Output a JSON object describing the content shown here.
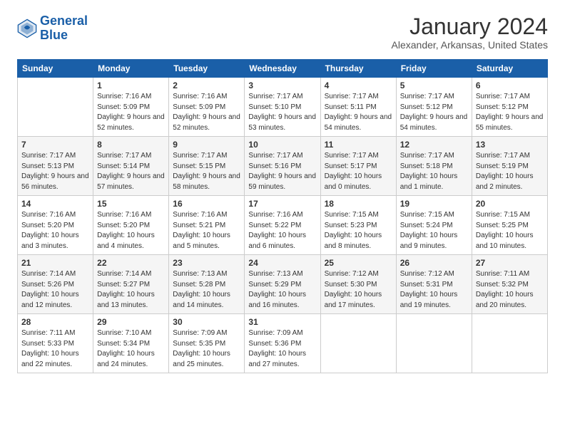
{
  "logo": {
    "line1": "General",
    "line2": "Blue"
  },
  "title": "January 2024",
  "subtitle": "Alexander, Arkansas, United States",
  "weekdays": [
    "Sunday",
    "Monday",
    "Tuesday",
    "Wednesday",
    "Thursday",
    "Friday",
    "Saturday"
  ],
  "weeks": [
    [
      {
        "day": "",
        "sunrise": "",
        "sunset": "",
        "daylight": ""
      },
      {
        "day": "1",
        "sunrise": "Sunrise: 7:16 AM",
        "sunset": "Sunset: 5:09 PM",
        "daylight": "Daylight: 9 hours and 52 minutes."
      },
      {
        "day": "2",
        "sunrise": "Sunrise: 7:16 AM",
        "sunset": "Sunset: 5:09 PM",
        "daylight": "Daylight: 9 hours and 52 minutes."
      },
      {
        "day": "3",
        "sunrise": "Sunrise: 7:17 AM",
        "sunset": "Sunset: 5:10 PM",
        "daylight": "Daylight: 9 hours and 53 minutes."
      },
      {
        "day": "4",
        "sunrise": "Sunrise: 7:17 AM",
        "sunset": "Sunset: 5:11 PM",
        "daylight": "Daylight: 9 hours and 54 minutes."
      },
      {
        "day": "5",
        "sunrise": "Sunrise: 7:17 AM",
        "sunset": "Sunset: 5:12 PM",
        "daylight": "Daylight: 9 hours and 54 minutes."
      },
      {
        "day": "6",
        "sunrise": "Sunrise: 7:17 AM",
        "sunset": "Sunset: 5:12 PM",
        "daylight": "Daylight: 9 hours and 55 minutes."
      }
    ],
    [
      {
        "day": "7",
        "sunrise": "Sunrise: 7:17 AM",
        "sunset": "Sunset: 5:13 PM",
        "daylight": "Daylight: 9 hours and 56 minutes."
      },
      {
        "day": "8",
        "sunrise": "Sunrise: 7:17 AM",
        "sunset": "Sunset: 5:14 PM",
        "daylight": "Daylight: 9 hours and 57 minutes."
      },
      {
        "day": "9",
        "sunrise": "Sunrise: 7:17 AM",
        "sunset": "Sunset: 5:15 PM",
        "daylight": "Daylight: 9 hours and 58 minutes."
      },
      {
        "day": "10",
        "sunrise": "Sunrise: 7:17 AM",
        "sunset": "Sunset: 5:16 PM",
        "daylight": "Daylight: 9 hours and 59 minutes."
      },
      {
        "day": "11",
        "sunrise": "Sunrise: 7:17 AM",
        "sunset": "Sunset: 5:17 PM",
        "daylight": "Daylight: 10 hours and 0 minutes."
      },
      {
        "day": "12",
        "sunrise": "Sunrise: 7:17 AM",
        "sunset": "Sunset: 5:18 PM",
        "daylight": "Daylight: 10 hours and 1 minute."
      },
      {
        "day": "13",
        "sunrise": "Sunrise: 7:17 AM",
        "sunset": "Sunset: 5:19 PM",
        "daylight": "Daylight: 10 hours and 2 minutes."
      }
    ],
    [
      {
        "day": "14",
        "sunrise": "Sunrise: 7:16 AM",
        "sunset": "Sunset: 5:20 PM",
        "daylight": "Daylight: 10 hours and 3 minutes."
      },
      {
        "day": "15",
        "sunrise": "Sunrise: 7:16 AM",
        "sunset": "Sunset: 5:20 PM",
        "daylight": "Daylight: 10 hours and 4 minutes."
      },
      {
        "day": "16",
        "sunrise": "Sunrise: 7:16 AM",
        "sunset": "Sunset: 5:21 PM",
        "daylight": "Daylight: 10 hours and 5 minutes."
      },
      {
        "day": "17",
        "sunrise": "Sunrise: 7:16 AM",
        "sunset": "Sunset: 5:22 PM",
        "daylight": "Daylight: 10 hours and 6 minutes."
      },
      {
        "day": "18",
        "sunrise": "Sunrise: 7:15 AM",
        "sunset": "Sunset: 5:23 PM",
        "daylight": "Daylight: 10 hours and 8 minutes."
      },
      {
        "day": "19",
        "sunrise": "Sunrise: 7:15 AM",
        "sunset": "Sunset: 5:24 PM",
        "daylight": "Daylight: 10 hours and 9 minutes."
      },
      {
        "day": "20",
        "sunrise": "Sunrise: 7:15 AM",
        "sunset": "Sunset: 5:25 PM",
        "daylight": "Daylight: 10 hours and 10 minutes."
      }
    ],
    [
      {
        "day": "21",
        "sunrise": "Sunrise: 7:14 AM",
        "sunset": "Sunset: 5:26 PM",
        "daylight": "Daylight: 10 hours and 12 minutes."
      },
      {
        "day": "22",
        "sunrise": "Sunrise: 7:14 AM",
        "sunset": "Sunset: 5:27 PM",
        "daylight": "Daylight: 10 hours and 13 minutes."
      },
      {
        "day": "23",
        "sunrise": "Sunrise: 7:13 AM",
        "sunset": "Sunset: 5:28 PM",
        "daylight": "Daylight: 10 hours and 14 minutes."
      },
      {
        "day": "24",
        "sunrise": "Sunrise: 7:13 AM",
        "sunset": "Sunset: 5:29 PM",
        "daylight": "Daylight: 10 hours and 16 minutes."
      },
      {
        "day": "25",
        "sunrise": "Sunrise: 7:12 AM",
        "sunset": "Sunset: 5:30 PM",
        "daylight": "Daylight: 10 hours and 17 minutes."
      },
      {
        "day": "26",
        "sunrise": "Sunrise: 7:12 AM",
        "sunset": "Sunset: 5:31 PM",
        "daylight": "Daylight: 10 hours and 19 minutes."
      },
      {
        "day": "27",
        "sunrise": "Sunrise: 7:11 AM",
        "sunset": "Sunset: 5:32 PM",
        "daylight": "Daylight: 10 hours and 20 minutes."
      }
    ],
    [
      {
        "day": "28",
        "sunrise": "Sunrise: 7:11 AM",
        "sunset": "Sunset: 5:33 PM",
        "daylight": "Daylight: 10 hours and 22 minutes."
      },
      {
        "day": "29",
        "sunrise": "Sunrise: 7:10 AM",
        "sunset": "Sunset: 5:34 PM",
        "daylight": "Daylight: 10 hours and 24 minutes."
      },
      {
        "day": "30",
        "sunrise": "Sunrise: 7:09 AM",
        "sunset": "Sunset: 5:35 PM",
        "daylight": "Daylight: 10 hours and 25 minutes."
      },
      {
        "day": "31",
        "sunrise": "Sunrise: 7:09 AM",
        "sunset": "Sunset: 5:36 PM",
        "daylight": "Daylight: 10 hours and 27 minutes."
      },
      {
        "day": "",
        "sunrise": "",
        "sunset": "",
        "daylight": ""
      },
      {
        "day": "",
        "sunrise": "",
        "sunset": "",
        "daylight": ""
      },
      {
        "day": "",
        "sunrise": "",
        "sunset": "",
        "daylight": ""
      }
    ]
  ]
}
